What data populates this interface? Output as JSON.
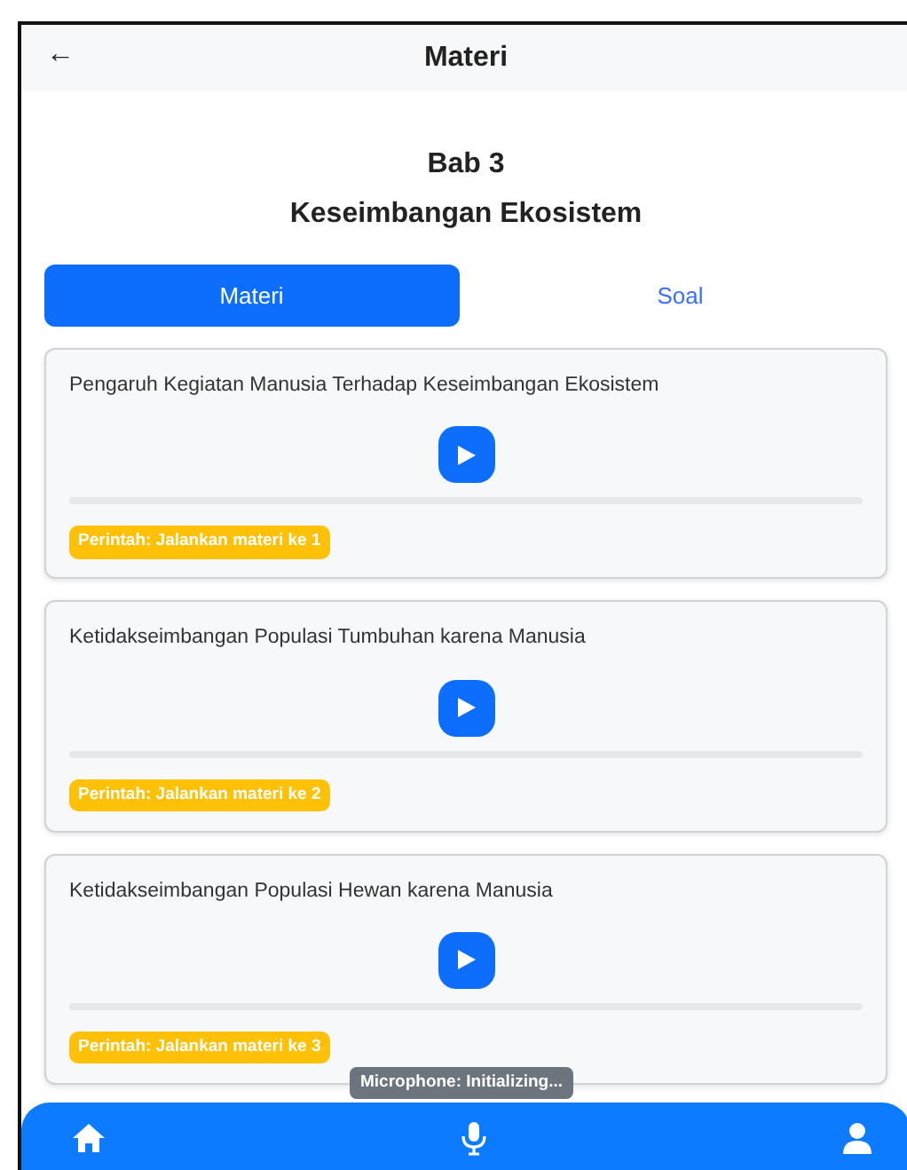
{
  "header": {
    "back": "←",
    "title": "Materi"
  },
  "chapter": {
    "number": "Bab 3",
    "title": "Keseimbangan Ekosistem"
  },
  "tabs": [
    {
      "label": "Materi",
      "selected": true
    },
    {
      "label": "Soal",
      "selected": false
    }
  ],
  "lessons": [
    {
      "title": "Pengaruh Kegiatan Manusia Terhadap Keseimbangan Ekosistem",
      "level": 0,
      "command": "Perintah: Jalankan materi ke 1"
    },
    {
      "title": "Ketidakseimbangan Populasi Tumbuhan karena Manusia",
      "level": 0,
      "command": "Perintah: Jalankan materi ke 2"
    },
    {
      "title": "Ketidakseimbangan Populasi Hewan karena Manusia",
      "level": 0,
      "command": "Perintah: Jalankan materi ke 3"
    }
  ],
  "toast": "Microphone: Initializing..."
}
